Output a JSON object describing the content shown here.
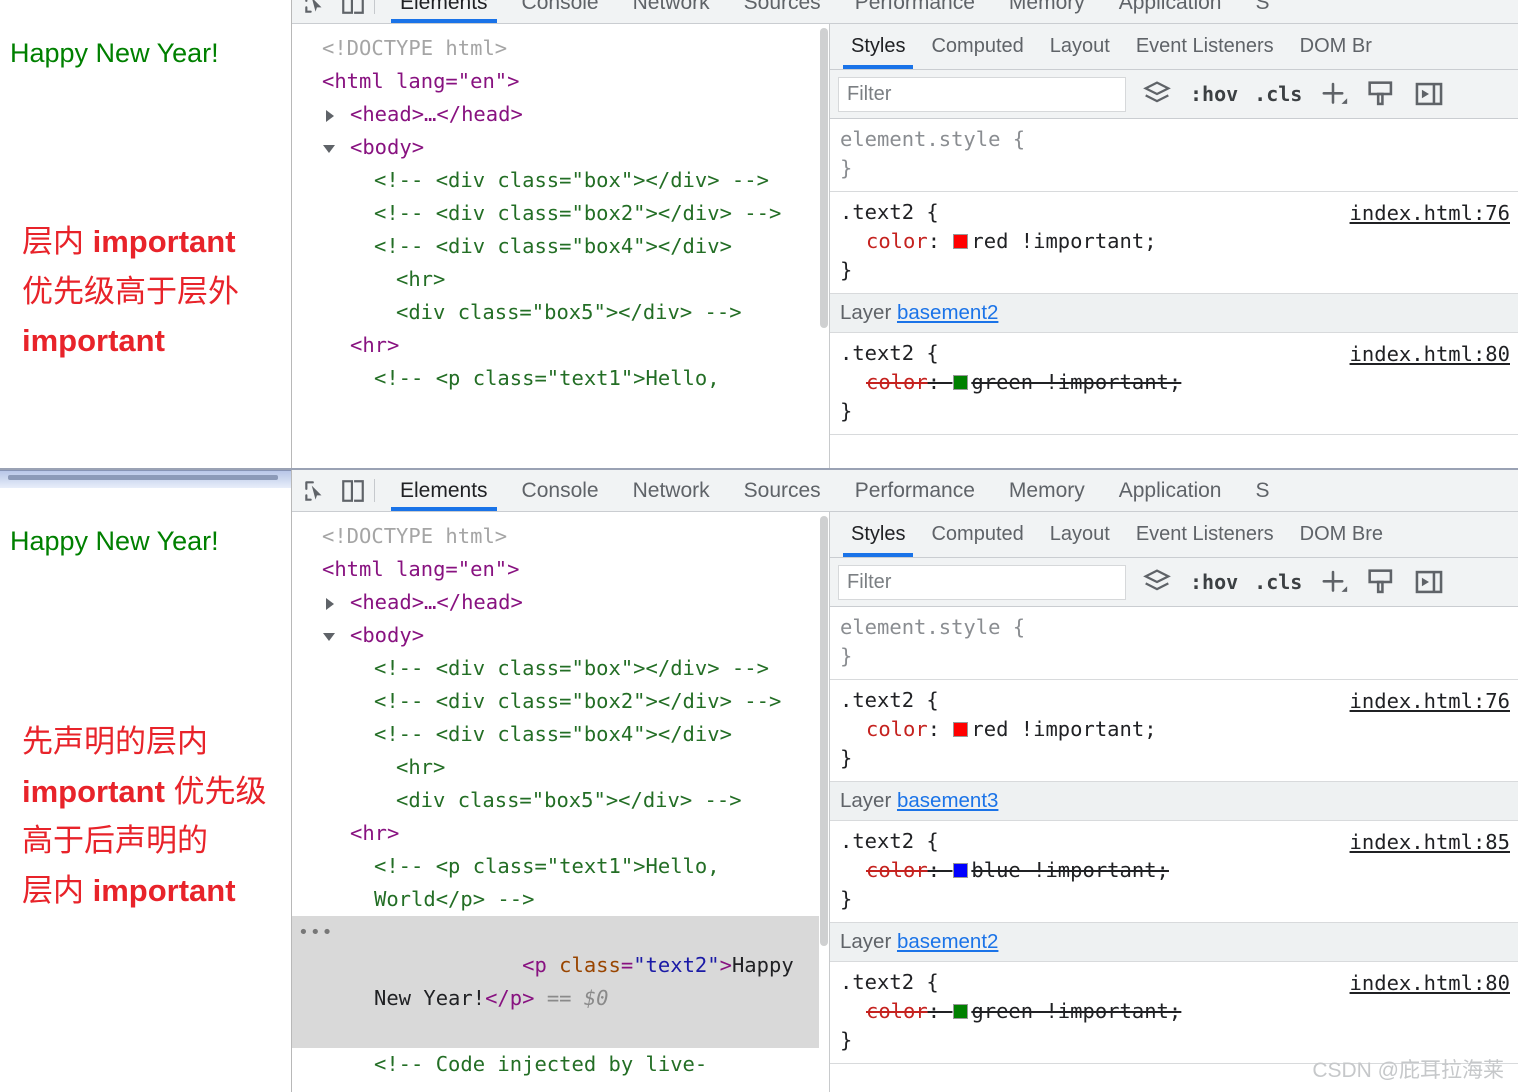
{
  "window_top": {
    "page": {
      "heading": "Happy New Year!",
      "note_line1": "层内 ",
      "note_bold1": "important",
      "note_line2": "优先级高于层外",
      "note_bold2": "important"
    },
    "main_tabs": [
      {
        "label": "Elements",
        "active": true
      },
      {
        "label": "Console",
        "active": false
      },
      {
        "label": "Network",
        "active": false
      },
      {
        "label": "Sources",
        "active": false
      },
      {
        "label": "Performance",
        "active": false
      },
      {
        "label": "Memory",
        "active": false
      },
      {
        "label": "Application",
        "active": false
      },
      {
        "label": "S",
        "active": false
      }
    ],
    "dom": {
      "doctype": "<!DOCTYPE html>",
      "html_open": "<html lang=\"en\">",
      "head": "<head>…</head>",
      "body_open": "<body>",
      "comment_box": "<!-- <div class=\"box\"></div> -->",
      "comment_box2": "<!-- <div class=\"box2\"></div> -->",
      "comment_box4_l1": "<!-- <div class=\"box4\"></div>",
      "comment_box4_l2": "<hr>",
      "comment_box4_l3": "<div class=\"box5\"></div> -->",
      "hr": "<hr>",
      "comment_text1": "<!-- <p class=\"text1\">Hello,"
    },
    "sub_tabs": [
      {
        "label": "Styles",
        "active": true
      },
      {
        "label": "Computed",
        "active": false
      },
      {
        "label": "Layout",
        "active": false
      },
      {
        "label": "Event Listeners",
        "active": false
      },
      {
        "label": "DOM Br",
        "active": false
      }
    ],
    "filter": {
      "placeholder": "Filter",
      "value": ""
    },
    "toolbar": {
      "hov": ":hov",
      "cls": ".cls"
    },
    "rules": [
      {
        "type": "rule",
        "selector": "element.style {",
        "close": "}",
        "origin": "",
        "declarations": [],
        "muted": true
      },
      {
        "type": "rule",
        "selector": ".text2 {",
        "close": "}",
        "origin": "index.html:76",
        "declarations": [
          {
            "prop": "color",
            "value": "red !important;",
            "swatch": "#ff0000",
            "struck": false
          }
        ]
      },
      {
        "type": "layer",
        "label": "Layer",
        "name": "basement2"
      },
      {
        "type": "rule",
        "selector": ".text2 {",
        "close": "}",
        "origin": "index.html:80",
        "declarations": [
          {
            "prop": "color",
            "value": "green !important;",
            "swatch": "#008000",
            "struck": true
          }
        ]
      }
    ]
  },
  "window_bottom": {
    "page": {
      "heading": "Happy New Year!",
      "note_line1": "先声明的层内",
      "note_bold1": "important",
      "note_line1b": " 优先级",
      "note_line2": "高于后声明的",
      "note_line3": "层内 ",
      "note_bold2": "important"
    },
    "main_tabs": [
      {
        "label": "Elements",
        "active": true
      },
      {
        "label": "Console",
        "active": false
      },
      {
        "label": "Network",
        "active": false
      },
      {
        "label": "Sources",
        "active": false
      },
      {
        "label": "Performance",
        "active": false
      },
      {
        "label": "Memory",
        "active": false
      },
      {
        "label": "Application",
        "active": false
      },
      {
        "label": "S",
        "active": false
      }
    ],
    "dom": {
      "doctype": "<!DOCTYPE html>",
      "html_open": "<html lang=\"en\">",
      "head": "<head>…</head>",
      "body_open": "<body>",
      "comment_box": "<!-- <div class=\"box\"></div> -->",
      "comment_box2": "<!-- <div class=\"box2\"></div> -->",
      "comment_box4_l1": "<!-- <div class=\"box4\"></div>",
      "comment_box4_l2": "<hr>",
      "comment_box4_l3": "<div class=\"box5\"></div> -->",
      "hr": "<hr>",
      "comment_text1": "<!-- <p class=\"text1\">Hello, World</p> -->",
      "selected_p_open": "<p class=\"text2\">",
      "selected_p_text": "Happy New Year!",
      "selected_p_close": "</p>",
      "selected_eq": "==",
      "selected_dollar": "$0",
      "comment_injected": "<!-- Code injected by live-"
    },
    "sub_tabs": [
      {
        "label": "Styles",
        "active": true
      },
      {
        "label": "Computed",
        "active": false
      },
      {
        "label": "Layout",
        "active": false
      },
      {
        "label": "Event Listeners",
        "active": false
      },
      {
        "label": "DOM Bre",
        "active": false
      }
    ],
    "filter": {
      "placeholder": "Filter",
      "value": ""
    },
    "toolbar": {
      "hov": ":hov",
      "cls": ".cls"
    },
    "rules": [
      {
        "type": "rule",
        "selector": "element.style {",
        "close": "}",
        "origin": "",
        "declarations": [],
        "muted": true
      },
      {
        "type": "rule",
        "selector": ".text2 {",
        "close": "}",
        "origin": "index.html:76",
        "declarations": [
          {
            "prop": "color",
            "value": "red !important;",
            "swatch": "#ff0000",
            "struck": false
          }
        ]
      },
      {
        "type": "layer",
        "label": "Layer",
        "name": "basement3"
      },
      {
        "type": "rule",
        "selector": ".text2 {",
        "close": "}",
        "origin": "index.html:85",
        "declarations": [
          {
            "prop": "color",
            "value": "blue !important;",
            "swatch": "#0000ff",
            "struck": true
          }
        ]
      },
      {
        "type": "layer",
        "label": "Layer",
        "name": "basement2"
      },
      {
        "type": "rule",
        "selector": ".text2 {",
        "close": "}",
        "origin": "index.html:80",
        "declarations": [
          {
            "prop": "color",
            "value": "green !important;",
            "swatch": "#008000",
            "struck": true
          }
        ]
      }
    ],
    "watermark": "CSDN @庇耳拉海莱"
  },
  "colors": {
    "accent": "#1a73e8",
    "page_text_green": "#008000",
    "note_red": "#e8232a",
    "comment_green": "#236e25",
    "tag_purple": "#881280",
    "attr_orange": "#994500",
    "value_blue": "#1a1aa6",
    "prop_red": "#c5221f"
  }
}
